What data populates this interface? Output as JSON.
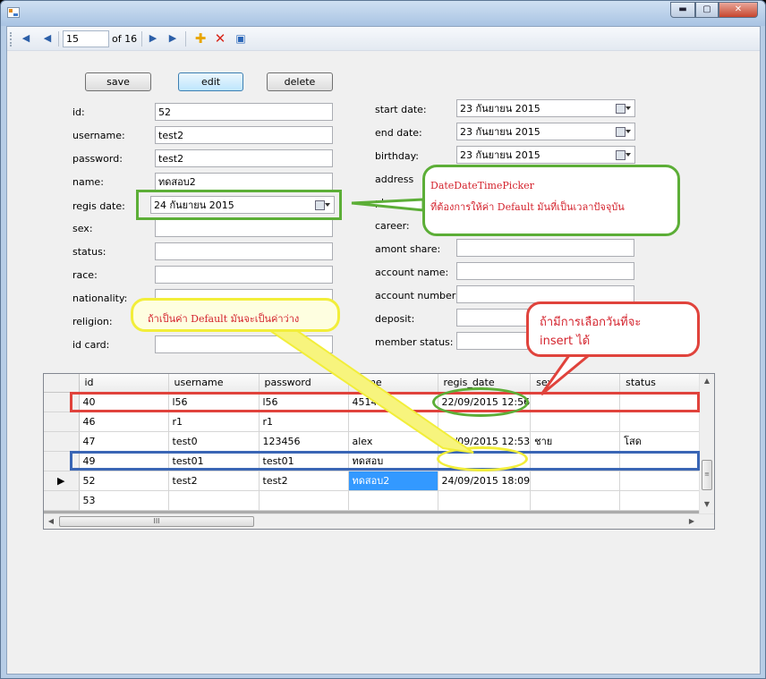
{
  "window": {
    "minimize_glyph": "▬",
    "maximize_glyph": "▢",
    "close_glyph": "✕"
  },
  "navigator": {
    "position": "15",
    "count_label": "of 16",
    "icons": [
      "move-first-icon",
      "move-previous-icon",
      "move-next-icon",
      "move-last-icon",
      "add-new-icon",
      "delete-icon",
      "save-icon"
    ]
  },
  "buttons": {
    "save": "save",
    "edit": "edit",
    "delete": "delete"
  },
  "form": {
    "left": [
      {
        "label": "id:",
        "value": "52"
      },
      {
        "label": "username:",
        "value": "test2"
      },
      {
        "label": "password:",
        "value": "test2"
      },
      {
        "label": "name:",
        "value": "ทดสอบ2"
      },
      {
        "label": "regis date:",
        "value": "24  กันยายน  2015"
      },
      {
        "label": "sex:",
        "value": ""
      },
      {
        "label": "status:",
        "value": ""
      },
      {
        "label": "race:",
        "value": ""
      },
      {
        "label": "nationality:",
        "value": ""
      },
      {
        "label": "religion:",
        "value": ""
      },
      {
        "label": "id card:",
        "value": ""
      }
    ],
    "right": [
      {
        "label": "start date:",
        "value": "23  กันยายน  2015"
      },
      {
        "label": "end date:",
        "value": "23  กันยายน  2015"
      },
      {
        "label": "birthday:",
        "value": "23  กันยายน  2015"
      },
      {
        "label": "address",
        "value": ""
      },
      {
        "label": "phone:",
        "value": ""
      },
      {
        "label": "career:",
        "value": ""
      },
      {
        "label": "amont share:",
        "value": ""
      },
      {
        "label": "account name:",
        "value": ""
      },
      {
        "label": "account number:",
        "value": ""
      },
      {
        "label": "deposit:",
        "value": ""
      },
      {
        "label": "member status:",
        "value": ""
      }
    ]
  },
  "grid": {
    "columns": [
      "id",
      "username",
      "password",
      "name",
      "regis_date",
      "sex",
      "status"
    ],
    "rows": [
      {
        "marker": "",
        "cells": [
          "40",
          "l56",
          "l56",
          "45145",
          "22/09/2015 12:56",
          "",
          ""
        ]
      },
      {
        "marker": "",
        "cells": [
          "46",
          "r1",
          "r1",
          "",
          "",
          "",
          ""
        ]
      },
      {
        "marker": "",
        "cells": [
          "47",
          "test0",
          "123456",
          "alex",
          "23/09/2015 12:53",
          "ชาย",
          "โสด"
        ]
      },
      {
        "marker": "",
        "cells": [
          "49",
          "test01",
          "test01",
          "ทดสอบ",
          "",
          "",
          ""
        ]
      },
      {
        "marker": "▶",
        "cells": [
          "52",
          "test2",
          "test2",
          "ทดสอบ2",
          "24/09/2015 18:09",
          "",
          ""
        ]
      },
      {
        "marker": "",
        "cells": [
          "53",
          "",
          "",
          "",
          "",
          "",
          ""
        ]
      }
    ],
    "hscroll_thumb": "III"
  },
  "annotations": {
    "green_title": "DateDateTimePicker",
    "green_text": "ที่ต้องการให้ค่า Default มันที่เป็นเวลาปัจจุบัน",
    "yellow_text": "ถ้าเป็นค่า Default มันจะเป็นค่าว่าง",
    "red_text_1": "ถ้ามีการเลือกวันที่จะ",
    "red_text_2": "insert ได้"
  },
  "colors": {
    "annotation_green": "#5cae37",
    "annotation_yellow": "#f2ee3a",
    "annotation_red": "#e0433c",
    "annotation_blue": "#3a66b5",
    "selection_blue": "#3399ff"
  }
}
